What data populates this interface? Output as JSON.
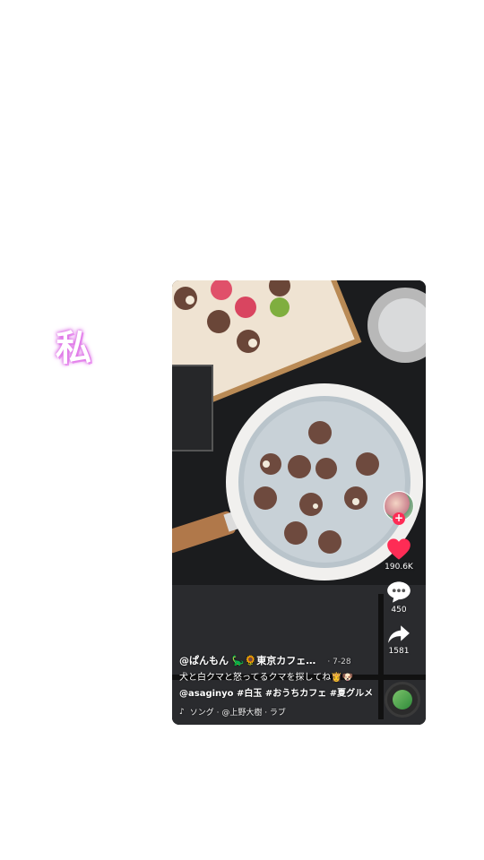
{
  "sticker": {
    "text": "私"
  },
  "post": {
    "author": "@ぱんもん 🦕🌻東京カフェ…",
    "date": "· 7-28",
    "caption": "犬と白クマと怒ってるクマを探してね👸🐶",
    "tags": "@asaginyo #白玉 #おうちカフェ #夏グルメ",
    "music": "ソング · @上野大樹 · ラブ"
  },
  "actions": {
    "likes": "190.6K",
    "comments": "450",
    "shares": "1581"
  },
  "colors": {
    "accent": "#fe2c55",
    "sticker_glow": "#e07be8"
  },
  "icons": [
    "plus-icon",
    "heart-icon",
    "comment-icon",
    "share-icon",
    "music-note-icon",
    "music-disc-icon"
  ]
}
